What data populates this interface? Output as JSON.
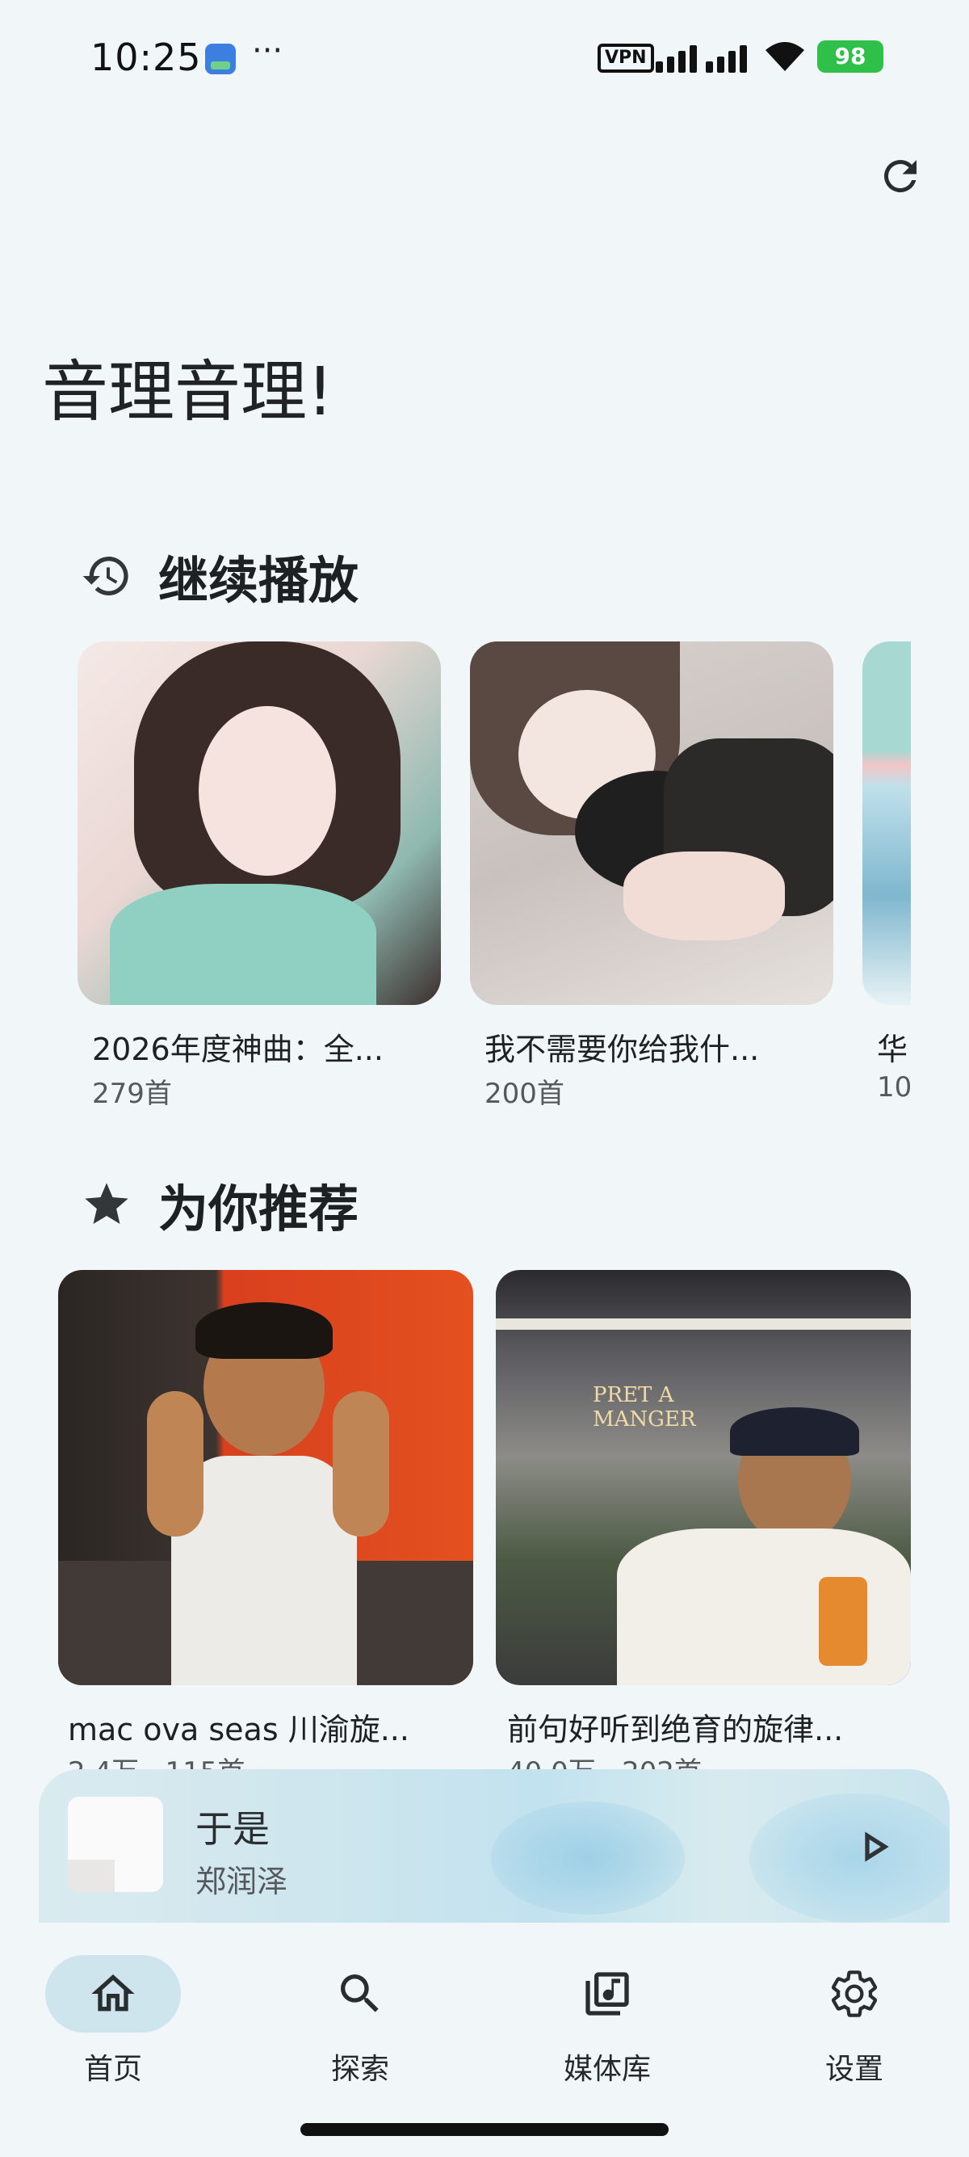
{
  "status_bar": {
    "time": "10:25",
    "more": "···",
    "vpn": "VPN",
    "battery": "98"
  },
  "header": {
    "title": "音理音理!"
  },
  "continue_section": {
    "heading": "继续播放",
    "items": [
      {
        "title": "2026年度神曲：全...",
        "subtitle": "279首"
      },
      {
        "title": "我不需要你给我什...",
        "subtitle": "200首"
      },
      {
        "title": "华",
        "subtitle": "10"
      }
    ]
  },
  "recommend_section": {
    "heading": "为你推荐",
    "items": [
      {
        "title": "mac ova seas 川渝旋...",
        "subtitle": "2.4万 · 115首"
      },
      {
        "title": "前句好听到绝育的旋律...",
        "subtitle": "40.0万 · 202首"
      }
    ]
  },
  "mini_player": {
    "title": "于是",
    "artist": "郑润泽"
  },
  "bottom_nav": {
    "items": [
      {
        "label": "首页",
        "icon": "home-icon",
        "active": true
      },
      {
        "label": "探索",
        "icon": "search-icon",
        "active": false
      },
      {
        "label": "媒体库",
        "icon": "library-music-icon",
        "active": false
      },
      {
        "label": "设置",
        "icon": "gear-icon",
        "active": false
      }
    ]
  },
  "colors": {
    "background": "#f1f6f9",
    "nav_active": "#cfe5ee",
    "battery": "#2fc04a"
  }
}
